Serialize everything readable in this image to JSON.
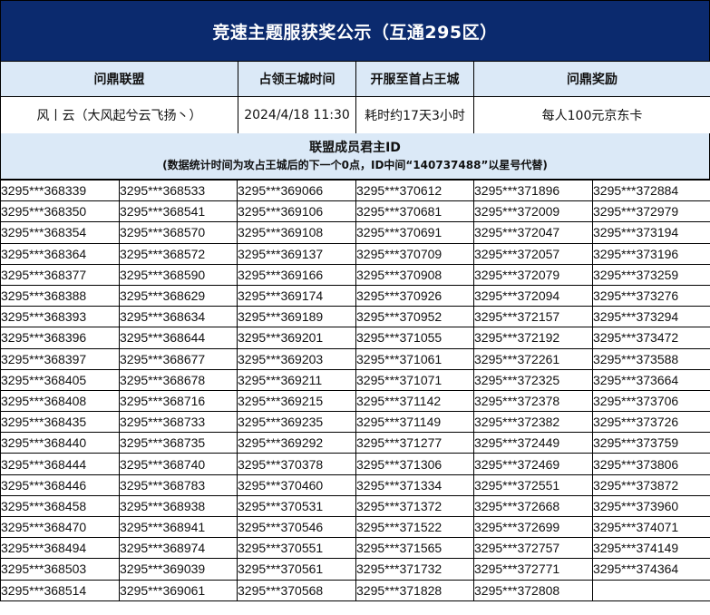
{
  "title": "竞速主题服获奖公示（互通295区）",
  "headers": [
    "问鼎联盟",
    "占领王城时间",
    "开服至首占王城",
    "问鼎奖励"
  ],
  "row": {
    "alliance": "风丨云（大风起兮云飞扬丶）",
    "time": "2024/4/18 11:30",
    "duration": "耗时约17天3小时",
    "reward": "每人100元京东卡"
  },
  "section": {
    "title": "联盟成员君主ID",
    "note": "(数据统计时间为攻占王城后的下一个0点，ID中间“140737488”以星号代替)"
  },
  "ids": [
    [
      "3295***368339",
      "3295***368533",
      "3295***369066",
      "3295***370612",
      "3295***371896",
      "3295***372884"
    ],
    [
      "3295***368350",
      "3295***368541",
      "3295***369106",
      "3295***370681",
      "3295***372009",
      "3295***372979"
    ],
    [
      "3295***368354",
      "3295***368570",
      "3295***369108",
      "3295***370691",
      "3295***372047",
      "3295***373194"
    ],
    [
      "3295***368364",
      "3295***368572",
      "3295***369137",
      "3295***370709",
      "3295***372057",
      "3295***373196"
    ],
    [
      "3295***368377",
      "3295***368590",
      "3295***369166",
      "3295***370908",
      "3295***372079",
      "3295***373259"
    ],
    [
      "3295***368388",
      "3295***368629",
      "3295***369174",
      "3295***370926",
      "3295***372094",
      "3295***373276"
    ],
    [
      "3295***368393",
      "3295***368634",
      "3295***369189",
      "3295***370952",
      "3295***372157",
      "3295***373294"
    ],
    [
      "3295***368396",
      "3295***368644",
      "3295***369201",
      "3295***371055",
      "3295***372192",
      "3295***373472"
    ],
    [
      "3295***368397",
      "3295***368677",
      "3295***369203",
      "3295***371061",
      "3295***372261",
      "3295***373588"
    ],
    [
      "3295***368405",
      "3295***368678",
      "3295***369211",
      "3295***371071",
      "3295***372325",
      "3295***373664"
    ],
    [
      "3295***368408",
      "3295***368716",
      "3295***369215",
      "3295***371142",
      "3295***372378",
      "3295***373706"
    ],
    [
      "3295***368435",
      "3295***368733",
      "3295***369235",
      "3295***371149",
      "3295***372382",
      "3295***373726"
    ],
    [
      "3295***368440",
      "3295***368735",
      "3295***369292",
      "3295***371277",
      "3295***372449",
      "3295***373759"
    ],
    [
      "3295***368444",
      "3295***368740",
      "3295***370378",
      "3295***371306",
      "3295***372469",
      "3295***373806"
    ],
    [
      "3295***368446",
      "3295***368783",
      "3295***370460",
      "3295***371334",
      "3295***372551",
      "3295***373872"
    ],
    [
      "3295***368458",
      "3295***368938",
      "3295***370531",
      "3295***371372",
      "3295***372668",
      "3295***373960"
    ],
    [
      "3295***368470",
      "3295***368941",
      "3295***370546",
      "3295***371522",
      "3295***372699",
      "3295***374071"
    ],
    [
      "3295***368494",
      "3295***368974",
      "3295***370551",
      "3295***371565",
      "3295***372757",
      "3295***374149"
    ],
    [
      "3295***368503",
      "3295***369039",
      "3295***370561",
      "3295***371732",
      "3295***372771",
      "3295***374364"
    ],
    [
      "3295***368514",
      "3295***369061",
      "3295***370568",
      "3295***371828",
      "3295***372808",
      ""
    ]
  ]
}
